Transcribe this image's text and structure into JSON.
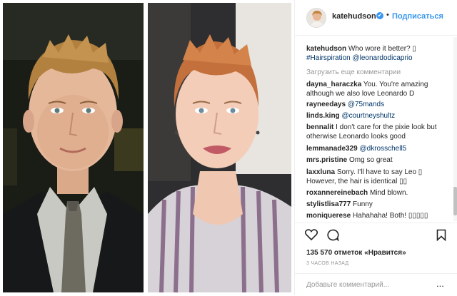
{
  "header": {
    "username": "katehudson",
    "verified_mark": "✔",
    "separator": "•",
    "follow_label": "Подписаться"
  },
  "caption": {
    "username": "katehudson",
    "text": "Who wore it better? ▯",
    "mention1": "#Hairspiration",
    "mention2": "@leonardodicaprio"
  },
  "load_more": "Загрузить еще комментарии",
  "comments": [
    {
      "user": "dayna_haraczka",
      "text": "You. You're amazing although we also love Leonardo D",
      "mention": ""
    },
    {
      "user": "rayneedays",
      "text": "",
      "mention": "@75mands"
    },
    {
      "user": "linds.king",
      "text": "",
      "mention": "@courtneyshultz"
    },
    {
      "user": "bennalit",
      "text": "I don't care for the pixie look but otherwise Leonardo looks good",
      "mention": ""
    },
    {
      "user": "lemmanade329",
      "text": "",
      "mention": "@dkrosschell5"
    },
    {
      "user": "mrs.pristine",
      "text": "Omg so great",
      "mention": ""
    },
    {
      "user": "laxxluna",
      "text": "Sorry. I'll have to say Leo ▯ However, the hair is identical ▯▯",
      "mention": ""
    },
    {
      "user": "roxannereinebach",
      "text": "Mind blown.",
      "mention": ""
    },
    {
      "user": "stylistlisa777",
      "text": "Funny",
      "mention": ""
    },
    {
      "user": "moniquerese",
      "text": "Hahahaha! Both! ▯▯▯▯▯",
      "mention": ""
    }
  ],
  "actions": {
    "like_icon": "heart-icon",
    "comment_icon": "comment-icon",
    "save_icon": "bookmark-icon",
    "likes_text": "135 570 отметок «Нравится»",
    "time_text": "3 ЧАСОВ НАЗАД",
    "add_comment_placeholder": "Добавьте комментарий...",
    "more_label": "..."
  },
  "colors": {
    "link": "#003569",
    "accent": "#3897f0",
    "muted": "#999999"
  }
}
